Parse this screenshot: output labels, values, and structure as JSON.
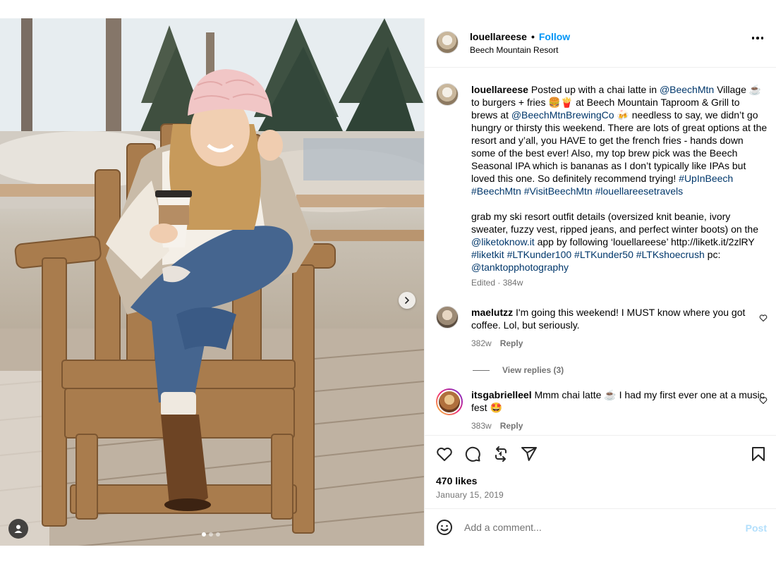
{
  "post": {
    "username": "louellareese",
    "separator": "•",
    "follow_label": "Follow",
    "location": "Beech Mountain Resort",
    "more_icon": "more-horizontal-icon"
  },
  "caption": {
    "username": "louellareese",
    "p1": " Posted up with a chai latte in ",
    "tag1": "@BeechMtn",
    "p2": " Village ☕ to burgers + fries 🍔🍟 at Beech Mountain Taproom & Grill to brews at ",
    "tag2": "@BeechMtnBrewingCo",
    "p3": " 🍻 needless to say, we didn’t go hungry or thirsty this weekend. There are lots of great options at the resort and y’all, you HAVE to get the french fries - hands down some of the best ever! Also, my top brew pick was the Beech Seasonal IPA which is bananas as I don’t typically like IPAs but loved this one. So definitely recommend trying!",
    "hashtags1": "#UpInBeech #BeechMtn #VisitBeechMtn #louellareesetravels",
    "p4": "grab my ski resort outfit details (oversized knit beanie, ivory sweater, fuzzy vest, ripped jeans, and perfect winter boots) on the ",
    "tag3": "@liketoknow.it",
    "p5": " app by following ‘louellareese’ http://liketk.it/2zlRY ",
    "hashtags2": "#liketkit #LTKunder100 #LTKunder50 #LTKshoecrush",
    "p6": " pc: ",
    "tag4": "@tanktopphotography",
    "meta": "Edited · 384w"
  },
  "comments": [
    {
      "username": "maelutzz",
      "text": " I'm going this weekend! I MUST know where you got coffee. Lol, but seriously.",
      "age": "382w",
      "reply_label": "Reply",
      "view_replies": "View replies (3)"
    },
    {
      "username": "itsgabrielleel",
      "text": " Mmm chai latte ☕ I had my first ever one at a music fest 🤩",
      "age": "383w",
      "reply_label": "Reply"
    }
  ],
  "actions": {
    "icons": [
      "heart-icon",
      "comment-icon",
      "repost-icon",
      "share-icon",
      "bookmark-icon"
    ],
    "likes": "470 likes",
    "date": "January 15, 2019"
  },
  "add_comment": {
    "placeholder": "Add a comment...",
    "post_label": "Post"
  },
  "carousel": {
    "slides": 3,
    "active": 0
  }
}
